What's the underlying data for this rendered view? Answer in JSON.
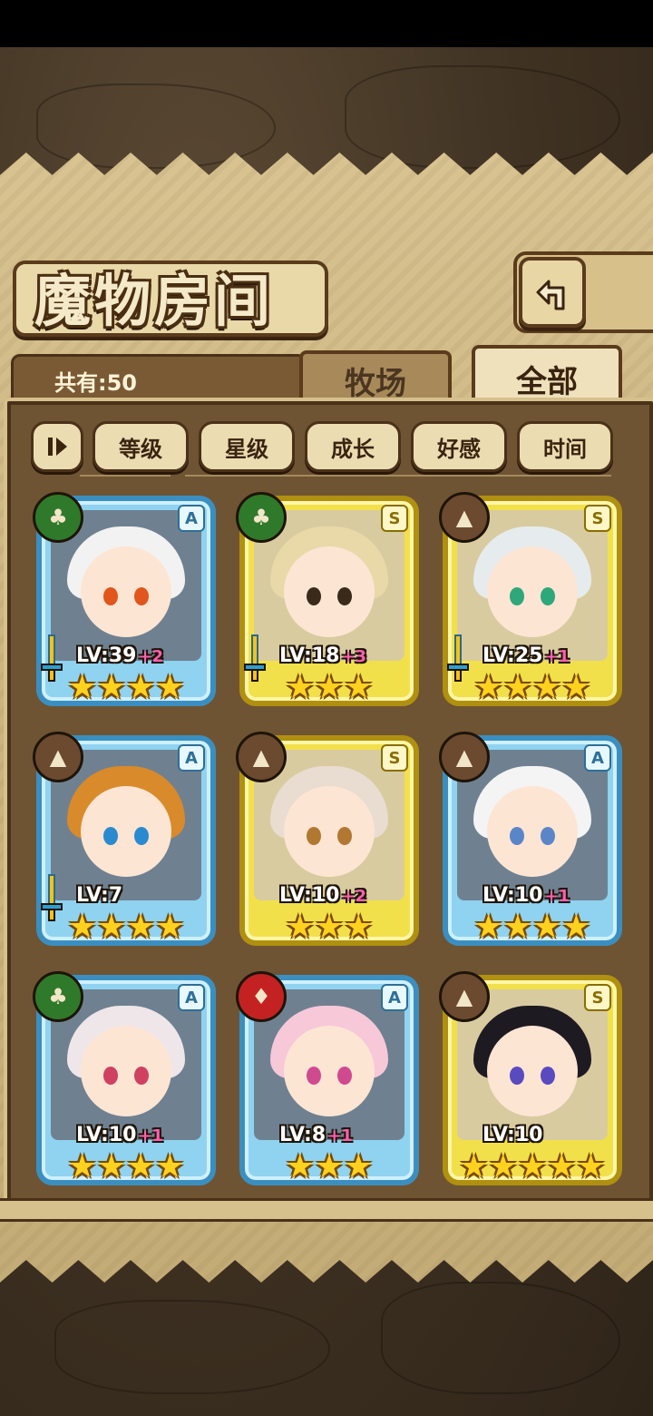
{
  "header": {
    "title": "魔物房间",
    "back_icon": "return-icon"
  },
  "count": {
    "text": "共有:50"
  },
  "tabs": [
    {
      "label": "牧场",
      "active": false
    },
    {
      "label": "全部",
      "active": true
    }
  ],
  "sort_buttons": [
    {
      "label": "等级"
    },
    {
      "label": "星级"
    },
    {
      "label": "成长"
    },
    {
      "label": "好感"
    },
    {
      "label": "时间"
    }
  ],
  "toggle_icon": "play-pause-icon",
  "monsters": [
    {
      "level": "LV:39",
      "bonus": "+2",
      "rarity": "A",
      "frame": "blue",
      "element": "nature",
      "stars": 4,
      "weapon": true,
      "hair": "#f2f2f2",
      "eye": "#e0561c"
    },
    {
      "level": "LV:18",
      "bonus": "+3",
      "rarity": "S",
      "frame": "gold",
      "element": "nature",
      "stars": 3,
      "weapon": true,
      "hair": "#e9d9a8",
      "eye": "#3a2a1a"
    },
    {
      "level": "LV:25",
      "bonus": "+1",
      "rarity": "S",
      "frame": "gold",
      "element": "earth",
      "stars": 4,
      "weapon": true,
      "hair": "#e6ecee",
      "eye": "#2ea77a"
    },
    {
      "level": "LV:7",
      "bonus": "",
      "rarity": "A",
      "frame": "blue",
      "element": "earth",
      "stars": 4,
      "weapon": true,
      "hair": "#d98a2a",
      "eye": "#2a8ad0"
    },
    {
      "level": "LV:10",
      "bonus": "+2",
      "rarity": "S",
      "frame": "gold",
      "element": "earth",
      "stars": 3,
      "weapon": false,
      "hair": "#e8ddd0",
      "eye": "#b07830"
    },
    {
      "level": "LV:10",
      "bonus": "+1",
      "rarity": "A",
      "frame": "blue",
      "element": "earth",
      "stars": 4,
      "weapon": false,
      "hair": "#f4f4f4",
      "eye": "#5a86c8"
    },
    {
      "level": "LV:10",
      "bonus": "+1",
      "rarity": "A",
      "frame": "blue",
      "element": "nature",
      "stars": 4,
      "weapon": false,
      "hair": "#efe6ea",
      "eye": "#d04060"
    },
    {
      "level": "LV:8",
      "bonus": "+1",
      "rarity": "A",
      "frame": "blue",
      "element": "fire",
      "stars": 3,
      "weapon": false,
      "hair": "#f6c8d8",
      "eye": "#d04a90"
    },
    {
      "level": "LV:10",
      "bonus": "",
      "rarity": "S",
      "frame": "gold",
      "element": "earth",
      "stars": 5,
      "weapon": false,
      "hair": "#1e1a22",
      "eye": "#5a4ac0"
    }
  ]
}
